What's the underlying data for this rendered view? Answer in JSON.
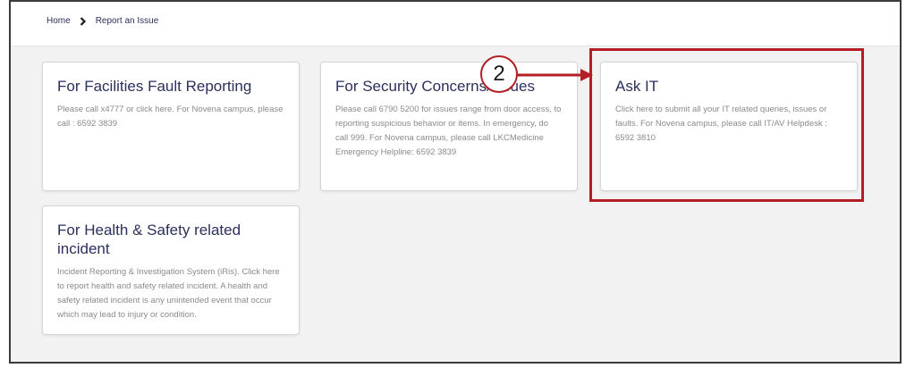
{
  "breadcrumb": {
    "home": "Home",
    "current": "Report an Issue"
  },
  "cards": {
    "facilities": {
      "title": "For Facilities Fault Reporting",
      "body": "Please call x4777 or click here. For Novena campus, please call : 6592 3839"
    },
    "security": {
      "title": "For Security Concerns/Issues",
      "body": "Please call 6790 5200 for issues range from door access, to reporting suspicious behavior or items. In emergency, do call 999. For Novena campus, please call LKCMedicine Emergency Helpline: 6592 3839"
    },
    "ask_it": {
      "title": "Ask IT",
      "body": "Click here to submit all your IT related queries, issues or faults. For Novena campus, please call IT/AV Helpdesk : 6592 3810"
    },
    "health_safety": {
      "title": "For Health & Safety related incident",
      "body": "Incident Reporting & Investigation System (iRis). Click here to report health and safety related incident. A health and safety related incident is any unintended event that occur which may lead to injury or condition."
    }
  },
  "annotation": {
    "step_number": "2",
    "color": "#b31f24"
  },
  "icons": {
    "breadcrumb_separator": "chevron-right-icon"
  }
}
